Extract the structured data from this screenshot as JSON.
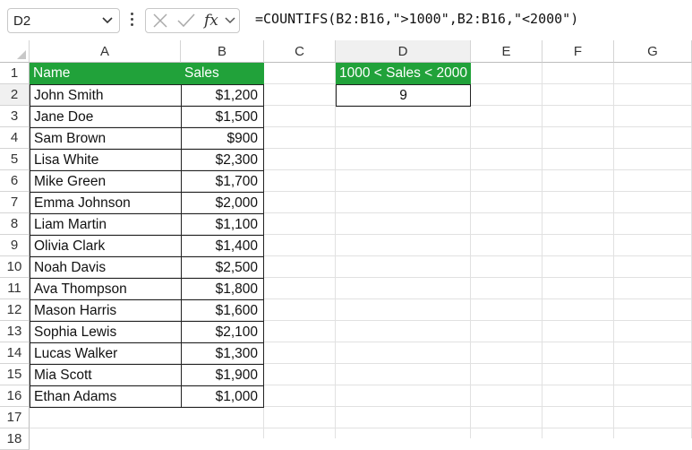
{
  "formula_bar": {
    "name_box": "D2",
    "formula": "=COUNTIFS(B2:B16,\">1000\",B2:B16,\"<2000\")"
  },
  "icons": {
    "chevron": "chevron-down-icon",
    "cancel": "cancel-x-icon",
    "enter": "checkmark-icon",
    "fx": "fx-function-icon"
  },
  "columns": [
    "A",
    "B",
    "C",
    "D",
    "E",
    "F",
    "G"
  ],
  "rows": [
    "1",
    "2",
    "3",
    "4",
    "5",
    "6",
    "7",
    "8",
    "9",
    "10",
    "11",
    "12",
    "13",
    "14",
    "15",
    "16",
    "17",
    "18"
  ],
  "table": {
    "headers": [
      "Name",
      "Sales"
    ],
    "rows": [
      [
        "John Smith",
        "$1,200"
      ],
      [
        "Jane Doe",
        "$1,500"
      ],
      [
        "Sam Brown",
        "$900"
      ],
      [
        "Lisa White",
        "$2,300"
      ],
      [
        "Mike Green",
        "$1,700"
      ],
      [
        "Emma Johnson",
        "$2,000"
      ],
      [
        "Liam Martin",
        "$1,100"
      ],
      [
        "Olivia Clark",
        "$1,400"
      ],
      [
        "Noah Davis",
        "$2,500"
      ],
      [
        "Ava Thompson",
        "$1,800"
      ],
      [
        "Mason Harris",
        "$1,600"
      ],
      [
        "Sophia Lewis",
        "$2,100"
      ],
      [
        "Lucas Walker",
        "$1,300"
      ],
      [
        "Mia Scott",
        "$1,900"
      ],
      [
        "Ethan Adams",
        "$1,000"
      ]
    ]
  },
  "result": {
    "header": "1000 < Sales < 2000",
    "value": "9"
  },
  "colors": {
    "header_fill": "#21a23a",
    "header_text": "#ffffff"
  }
}
